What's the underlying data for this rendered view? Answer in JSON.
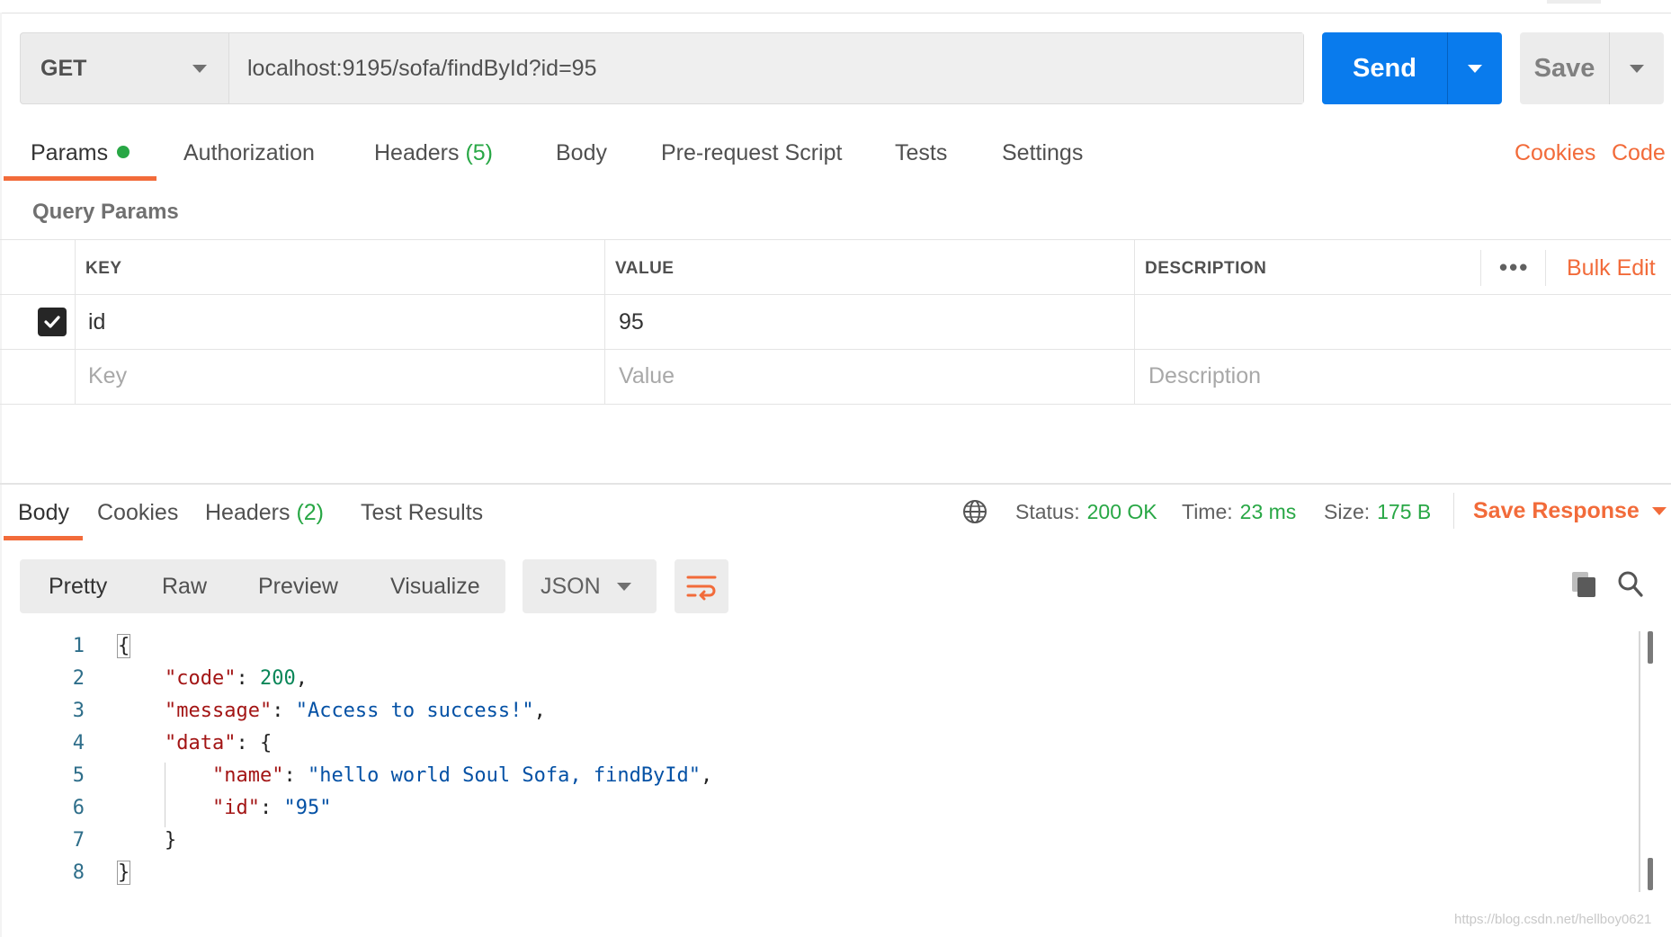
{
  "request": {
    "method": "GET",
    "url": "localhost:9195/sofa/findById?id=95",
    "send_label": "Send",
    "save_label": "Save"
  },
  "request_tabs": {
    "params": "Params",
    "authorization": "Authorization",
    "headers": "Headers",
    "headers_count": "(5)",
    "body": "Body",
    "prerequest": "Pre-request Script",
    "tests": "Tests",
    "settings": "Settings",
    "cookies": "Cookies",
    "code": "Code"
  },
  "query_params": {
    "title": "Query Params",
    "columns": {
      "key": "KEY",
      "value": "VALUE",
      "description": "DESCRIPTION"
    },
    "bulk_edit": "Bulk Edit",
    "more": "•••",
    "rows": [
      {
        "checked": true,
        "key": "id",
        "value": "95",
        "description": ""
      }
    ],
    "placeholders": {
      "key": "Key",
      "value": "Value",
      "description": "Description"
    }
  },
  "response": {
    "tabs": {
      "body": "Body",
      "cookies": "Cookies",
      "headers": "Headers",
      "headers_count": "(2)",
      "test_results": "Test Results"
    },
    "status_label": "Status:",
    "status_value": "200 OK",
    "time_label": "Time:",
    "time_value": "23 ms",
    "size_label": "Size:",
    "size_value": "175 B",
    "save_response": "Save Response",
    "formats": {
      "pretty": "Pretty",
      "raw": "Raw",
      "preview": "Preview",
      "visualize": "Visualize"
    },
    "language": "JSON",
    "body_lines": {
      "n1": "1",
      "n2": "2",
      "n3": "3",
      "n4": "4",
      "n5": "5",
      "n6": "6",
      "n7": "7",
      "n8": "8",
      "open_brace": "{",
      "code_key": "\"code\"",
      "code_val": "200",
      "message_key": "\"message\"",
      "message_val": "\"Access to success!\"",
      "data_key": "\"data\"",
      "name_key": "\"name\"",
      "name_val": "\"hello world Soul Sofa, findById\"",
      "id_key": "\"id\"",
      "id_val": "\"95\"",
      "close_inner": "}",
      "close_brace": "}"
    }
  },
  "watermark": "https://blog.csdn.net/hellboy0621",
  "colors": {
    "accent_orange": "#f26b3a",
    "send_blue": "#097bed",
    "success_green": "#28a745"
  },
  "icons": [
    "dropdown-caret-icon",
    "checkmark-icon",
    "globe-icon",
    "copy-icon",
    "search-icon",
    "wrap-lines-icon"
  ]
}
